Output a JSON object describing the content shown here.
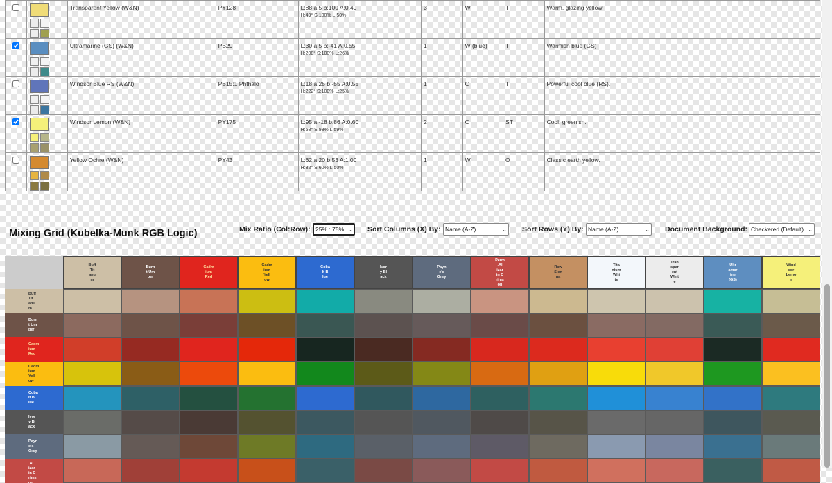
{
  "palette_rows": [
    {
      "checked": false,
      "name": "Transparent Yellow (W&N)",
      "pigment": "PY128",
      "lab": "L:88 a:5 b:100 A:0.40",
      "hsl": "H:49° S:100% L:50%",
      "rating": "3",
      "type": "W",
      "opacity": "T",
      "notes": "Warm, glazing yellow",
      "color": "#f0dc78",
      "minis": [
        "#ececec",
        "#f4f4f4",
        "#eeeeee",
        "#a0a050"
      ]
    },
    {
      "checked": true,
      "name": "Ultramarine (GS) (W&N)",
      "pigment": "PB29",
      "lab": "L:30 a:5 b:-41 A:0.55",
      "hsl": "H:208° S:100% L:26%",
      "rating": "1",
      "type": "W (blue)",
      "opacity": "T",
      "notes": "Warmish blue (GS)",
      "color": "#5a8ec0",
      "minis": [
        "#f0f0f0",
        "#f4f4f4",
        "#ececec",
        "#3f8a8a"
      ]
    },
    {
      "checked": false,
      "name": "Windsor Blue RS (W&N)",
      "pigment": "PB15:1 Phthalo",
      "lab": "L:18 a:25 b:-55 A:0.55",
      "hsl": "H:222° S:100% L:25%",
      "rating": "1",
      "type": "C",
      "opacity": "T",
      "notes": "Powerful cool blue (RS).",
      "color": "#6075ba",
      "minis": [
        "#efefef",
        "#f5f5f5",
        "#ebebeb",
        "#3c76a0"
      ]
    },
    {
      "checked": true,
      "name": "Windsor Lemon (W&N)",
      "pigment": "PY175",
      "lab": "L:95 a:-18 b:86 A:0.60",
      "hsl": "H:58° S:98% L:59%",
      "rating": "2",
      "type": "C",
      "opacity": "ST",
      "notes": "Cool, greenish.",
      "color": "#f5f07a",
      "minis": [
        "#f5f07a",
        "#b6b68a",
        "#a8a070",
        "#9a9268"
      ]
    },
    {
      "checked": false,
      "name": "Yellow Ochre (W&N)",
      "pigment": "PY43",
      "lab": "L:62 a:20 b:53 A:1.00",
      "hsl": "H:32° S:60% L:50%",
      "rating": "1",
      "type": "W",
      "opacity": "O",
      "notes": "Classic earth yellow.",
      "color": "#d48a30",
      "minis": [
        "#e6b440",
        "#b08a48",
        "#8a7a40",
        "#7a7040"
      ]
    }
  ],
  "mixing": {
    "title": "Mixing Grid (Kubelka-Munk RGB Logic)",
    "ratio_label": "Mix Ratio (Col:Row):",
    "ratio_value": "25% : 75%",
    "sort_cols_label": "Sort Columns (X) By:",
    "sort_cols_value": "Name (A-Z)",
    "sort_rows_label": "Sort Rows (Y) By:",
    "sort_rows_value": "Name (A-Z)",
    "bg_label": "Document Background:",
    "bg_value": "Checkered (Default)"
  },
  "grid": {
    "columns": [
      {
        "label": "Buff\nTit\nanu\nm",
        "color": "#cdbfa6",
        "text": "#333333"
      },
      {
        "label": "Burn\nt Um\nber",
        "color": "#6e5348",
        "text": "#ffffff"
      },
      {
        "label": "Cadm\nium\nRed",
        "color": "#e0251e",
        "text": "#ffe0a0"
      },
      {
        "label": "Cadm\nium\nYell\now",
        "color": "#fbbd10",
        "text": "#333333"
      },
      {
        "label": "Coba\nlt B\nlue",
        "color": "#2d6ad0",
        "text": "#ffffff"
      },
      {
        "label": "Ivor\ny Bl\nack",
        "color": "#555555",
        "text": "#ffffff"
      },
      {
        "label": "Payn\ne's\nGrey",
        "color": "#5e6b7e",
        "text": "#ffffff"
      },
      {
        "label": "Perm\n.Al\nizar\nin C\nrims\non",
        "color": "#c24a45",
        "text": "#ffffff"
      },
      {
        "label": "Raw\nSien\nna",
        "color": "#c49062",
        "text": "#333333"
      },
      {
        "label": "Tita\nnium\nWhi\nte",
        "color": "#f3f7fb",
        "text": "#333333"
      },
      {
        "label": "Tran\nspar\nent\nWhit\ne",
        "color": "#ececec",
        "text": "#333333"
      },
      {
        "label": "Ultr\namar\nine\n(GS)",
        "color": "#5e8ec0",
        "text": "#ffffff"
      },
      {
        "label": "Wind\nsor\nLemo\nn",
        "color": "#f5f07a",
        "text": "#333333"
      }
    ],
    "rows": [
      {
        "label": "Buff\nTit\nanu\nm",
        "color": "#cdbfa6",
        "text": "#333333",
        "cells": [
          "#cdbfa6",
          "#b69380",
          "#c87356",
          "#ccbe12",
          "#12aba8",
          "#898a80",
          "#acaea2",
          "#c99481",
          "#ccb990",
          "#cec5ae",
          "#ccc2ad",
          "#17b2a3",
          "#c6be95"
        ]
      },
      {
        "label": "Burn\nt Um\nber",
        "color": "#6e5348",
        "text": "#ffffff",
        "cells": [
          "#8c6a5f",
          "#6e5348",
          "#7a3e38",
          "#6d5026",
          "#3a5753",
          "#5c5250",
          "#665a5a",
          "#6a4b48",
          "#6b5040",
          "#8a6b63",
          "#836a63",
          "#3a5a56",
          "#6b5a4a"
        ]
      },
      {
        "label": "Cadm\nium\nRed",
        "color": "#e0251e",
        "text": "#ffe0a0",
        "cells": [
          "#d13e29",
          "#962a22",
          "#e0251e",
          "#e4280a",
          "#172620",
          "#4a2a22",
          "#852a22",
          "#d8281e",
          "#dc2a1e",
          "#e84030",
          "#e04035",
          "#1b2a24",
          "#e02a20"
        ]
      },
      {
        "label": "Cadm\nium\nYell\now",
        "color": "#fbbd10",
        "text": "#333333",
        "cells": [
          "#d7c30c",
          "#8a5c16",
          "#ec4a0c",
          "#fbbd10",
          "#12881c",
          "#5c5a18",
          "#848816",
          "#d86a12",
          "#e0a012",
          "#f8dc0a",
          "#f0c82a",
          "#1e9820",
          "#fbc020"
        ]
      },
      {
        "label": "Coba\nlt B\nlue",
        "color": "#2d6ad0",
        "text": "#ffffff",
        "cells": [
          "#2494bd",
          "#2e6066",
          "#245040",
          "#247230",
          "#2d6ad0",
          "#30585e",
          "#2e68a0",
          "#2e6060",
          "#2c7870",
          "#2090d8",
          "#3882d0",
          "#3272c8",
          "#2e7a7e"
        ]
      },
      {
        "label": "Ivor\ny Bl\nack",
        "color": "#555555",
        "text": "#ffffff",
        "cells": [
          "#6a6c68",
          "#554b48",
          "#4a3a35",
          "#545230",
          "#3c5860",
          "#555555",
          "#505860",
          "#4f4a48",
          "#575448",
          "#6a6a6a",
          "#666666",
          "#3e565e",
          "#5a5a50"
        ]
      },
      {
        "label": "Payn\ne's\nGrey",
        "color": "#5e6b7e",
        "text": "#ffffff",
        "cells": [
          "#8a9aa4",
          "#655a56",
          "#6e4838",
          "#6e7a26",
          "#2e6a80",
          "#5a6068",
          "#5e6b7e",
          "#5e5a66",
          "#6e6a60",
          "#8a9ab0",
          "#7a86a0",
          "#3a7090",
          "#6a7a7a"
        ]
      },
      {
        "label": "Perm\n.Al\nizar\nin C\nrims\non",
        "color": "#c24a45",
        "text": "#ffffff",
        "cells": [
          "#c86858",
          "#a04038",
          "#c43a30",
          "#c8501a",
          "#3a6068",
          "#7a4a45",
          "#8a5a5a",
          "#c24a45",
          "#c05a40",
          "#d0705e",
          "#c8685e",
          "#3a6060",
          "#c05a45"
        ]
      }
    ]
  },
  "colors": {
    "header_bg": "#e8e8e8",
    "grid_corner": "#cccccc",
    "accent_check": "#1a73e8"
  }
}
